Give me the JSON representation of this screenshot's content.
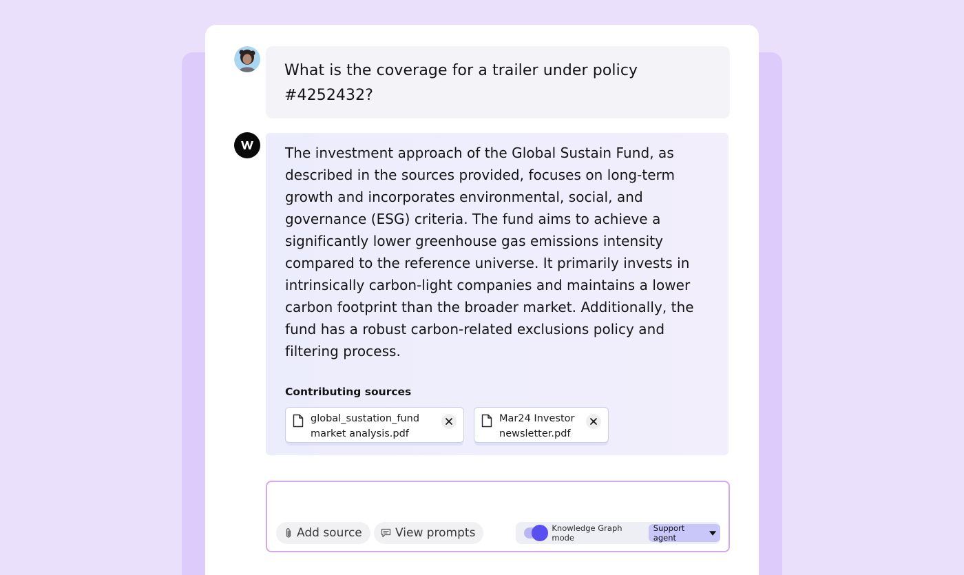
{
  "conversation": {
    "user_message": "What is the coverage for a trailer under policy #4252432?",
    "assistant_message": "The investment approach of the Global Sustain Fund, as described in the sources provided, focuses on long-term growth and incorporates environmental, social, and governance (ESG) criteria. The fund aims to achieve a significantly lower greenhouse gas emissions intensity compared to the reference universe. It primarily invests in intrinsically carbon-light companies and maintains a lower carbon footprint than the broader market. Additionally, the fund has a robust carbon-related exclusions policy and filtering process.",
    "sources_title": "Contributing sources",
    "sources": [
      {
        "line1": "global_sustation_fund",
        "line2": "market analysis.pdf",
        "icon": "file-icon"
      },
      {
        "line1": "Mar24 Investor",
        "line2": "newsletter.pdf",
        "icon": "file-icon"
      }
    ]
  },
  "composer": {
    "input_value": "",
    "add_source_label": "Add source",
    "view_prompts_label": "View prompts",
    "mode_label": "Knowledge Graph mode",
    "mode_enabled": true,
    "agent_selected": "Support agent"
  },
  "colors": {
    "page_bg": "#ebe0fc",
    "accent": "#5b4ef0",
    "composer_border": "#d7a8e8"
  }
}
